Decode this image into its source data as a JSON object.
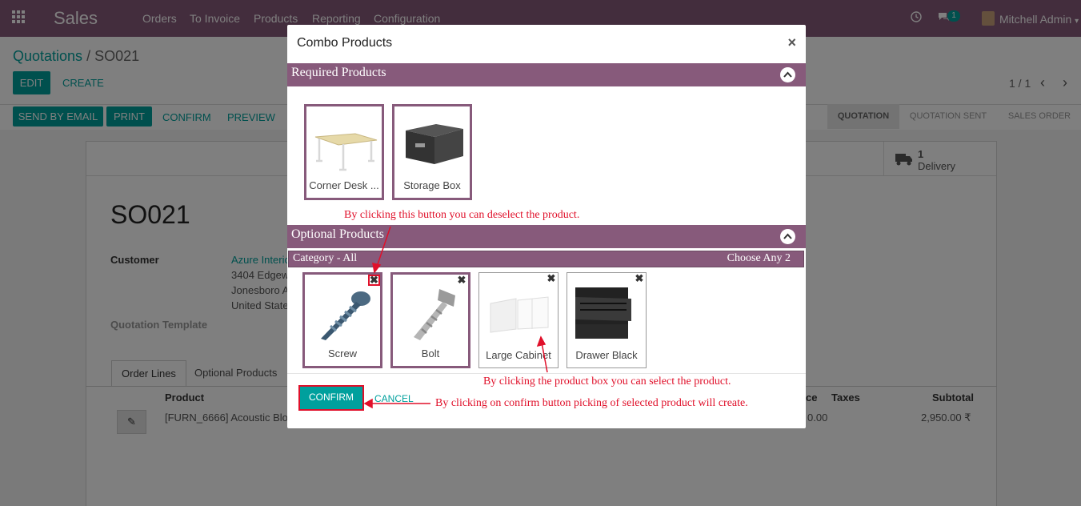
{
  "navbar": {
    "app_name": "Sales",
    "menu": [
      "Orders",
      "To Invoice",
      "Products",
      "Reporting",
      "Configuration"
    ],
    "message_count": "1",
    "user_name": "Mitchell Admin"
  },
  "page": {
    "breadcrumb_root": "Quotations",
    "breadcrumb_sep": "/",
    "breadcrumb_current": "SO021",
    "edit_label": "EDIT",
    "create_label": "CREATE",
    "pager": "1 / 1",
    "actions": {
      "send_email": "SEND BY EMAIL",
      "print": "PRINT",
      "confirm": "CONFIRM",
      "preview": "PREVIEW"
    },
    "status_steps": [
      "QUOTATION",
      "QUOTATION SENT",
      "SALES ORDER"
    ],
    "delivery_count": "1",
    "delivery_label": "Delivery",
    "order_name": "SO021",
    "customer_label": "Customer",
    "customer_name": "Azure Interio",
    "customer_addr1": "3404 Edgew",
    "customer_addr2": "Jonesboro A",
    "customer_addr3": "United State",
    "template_label": "Quotation Template",
    "tabs": [
      "Order Lines",
      "Optional Products"
    ],
    "columns": {
      "product": "Product",
      "price": "ce",
      "taxes": "Taxes",
      "subtotal": "Subtotal"
    },
    "line": {
      "product": "[FURN_6666] Acoustic Blo",
      "price": "0.00",
      "subtotal": "2,950.00 ₹"
    }
  },
  "modal": {
    "title": "Combo Products",
    "close": "×",
    "required_title": "Required Products",
    "required_products": [
      "Corner Desk ...",
      "Storage Box"
    ],
    "optional_title": "Optional Products",
    "category_label": "Category - All",
    "choose_label": "Choose Any 2",
    "optional_products": [
      "Screw",
      "Bolt",
      "Large Cabinet",
      "Drawer Black"
    ],
    "confirm_label": "CONFIRM",
    "cancel_label": "CANCEL"
  },
  "annotations": {
    "deselect": "By clicking this button you can deselect the product.",
    "select": "By clicking the product box you can select the product.",
    "confirm": "By clicking on confirm button picking of selected product will create."
  },
  "colors": {
    "brand": "#875a7b",
    "accent": "#00a09d",
    "annotation": "#e0102a"
  }
}
